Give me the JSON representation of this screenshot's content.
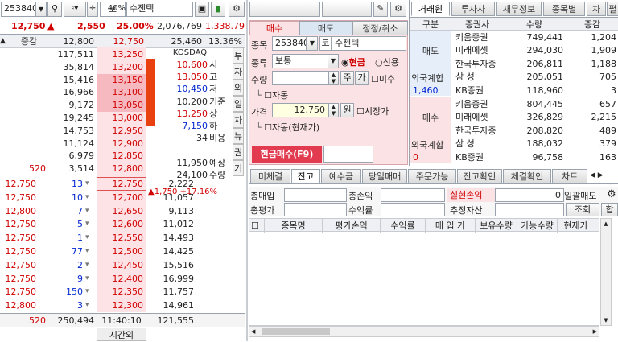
{
  "top": {
    "code": "253840",
    "extra": "코",
    "pct": "40%",
    "name": "수젠텍"
  },
  "summary": {
    "price": "12,750",
    "arrow": "▲",
    "change": "2,550",
    "rate": "25.00%",
    "volume": "2,076,769",
    "extra": "1,338.79"
  },
  "ob_header": {
    "label": "증감",
    "prev": "12,800",
    "cur": "12,750",
    "vol": "25,460",
    "ratio": "13.36%"
  },
  "asks": [
    {
      "cnt": "",
      "qty": "117,511",
      "price": "13,250"
    },
    {
      "cnt": "",
      "qty": "35,814",
      "price": "13,200"
    },
    {
      "cnt": "",
      "qty": "15,416",
      "price": "13,150"
    },
    {
      "cnt": "",
      "qty": "16,966",
      "price": "13,100"
    },
    {
      "cnt": "",
      "qty": "9,172",
      "price": "13,050"
    },
    {
      "cnt": "",
      "qty": "19,245",
      "price": "13,000"
    },
    {
      "cnt": "",
      "qty": "14,753",
      "price": "12,950"
    },
    {
      "cnt": "",
      "qty": "11,124",
      "price": "12,900"
    },
    {
      "cnt": "",
      "qty": "6,979",
      "price": "12,850"
    },
    {
      "cnt": "520",
      "qty": "3,514",
      "price": "12,800"
    }
  ],
  "info": {
    "market": "KOSDAQ",
    "rows": [
      {
        "v": "10,600",
        "k": "시"
      },
      {
        "v": "13,050",
        "k": "고"
      },
      {
        "v": "10,450",
        "k": "저"
      },
      {
        "v": "10,200",
        "k": "기준"
      },
      {
        "v": "13,250",
        "k": "상"
      },
      {
        "v": "7,150",
        "k": "하"
      },
      {
        "v": "34",
        "k": "비용"
      },
      {
        "v": "",
        "k": ""
      },
      {
        "v": "11,950",
        "k": "예상"
      },
      {
        "v": "24,100",
        "k": "수량"
      }
    ],
    "exp_arrow": "▲",
    "exp_change": "1,750",
    "exp_rate": "+17.16%"
  },
  "side_tabs": [
    "투",
    "자",
    "외",
    "일",
    "차",
    "뉴",
    "권",
    "기"
  ],
  "bids": [
    {
      "trade": "12,750",
      "tq": "13",
      "price": "12,750",
      "qty": "2,222"
    },
    {
      "trade": "12,750",
      "tq": "10",
      "price": "12,700",
      "qty": "11,057"
    },
    {
      "trade": "12,800",
      "tq": "7",
      "price": "12,650",
      "qty": "9,113"
    },
    {
      "trade": "12,750",
      "tq": "5",
      "price": "12,600",
      "qty": "11,012"
    },
    {
      "trade": "12,750",
      "tq": "1",
      "price": "12,550",
      "qty": "14,493"
    },
    {
      "trade": "12,750",
      "tq": "77",
      "price": "12,500",
      "qty": "14,425"
    },
    {
      "trade": "12,750",
      "tq": "2",
      "price": "12,450",
      "qty": "15,516"
    },
    {
      "trade": "12,750",
      "tq": "9",
      "price": "12,400",
      "qty": "16,999"
    },
    {
      "trade": "12,750",
      "tq": "150",
      "price": "12,350",
      "qty": "11,757"
    },
    {
      "trade": "12,800",
      "tq": "3",
      "price": "12,300",
      "qty": "14,961"
    }
  ],
  "ob_footer": {
    "cnt": "520",
    "ask_total": "250,494",
    "time": "11:40:10",
    "bid_total": "121,555",
    "after": "시간외"
  },
  "order": {
    "tabs": [
      "매수",
      "매도",
      "정정/취소"
    ],
    "code": "253840",
    "market": "코",
    "name": "수젠텍",
    "type_label": "종류",
    "type": "보통",
    "cash": "현금",
    "credit": "신용",
    "qty_label": "수량",
    "ju": "주",
    "ga": "가",
    "misu": "미수",
    "auto": "자동",
    "price_label": "가격",
    "price": "12,750",
    "won": "원",
    "market_price": "시장가",
    "auto2": "자동(현재가)",
    "submit": "현금매수(F9)",
    "code_label": "종목"
  },
  "broker": {
    "tabs": [
      "거래원",
      "투자자",
      "재무정보",
      "종목별",
      "차",
      "펼"
    ],
    "headers": [
      "구분",
      "증권사",
      "수량",
      "증감"
    ],
    "sell_label": "매도",
    "buy_label": "매수",
    "sells": [
      {
        "name": "키움증권",
        "qty": "749,441",
        "chg": "1,204"
      },
      {
        "name": "미래에셋",
        "qty": "294,030",
        "chg": "1,909"
      },
      {
        "name": "한국투자증",
        "qty": "206,811",
        "chg": "1,188"
      },
      {
        "name": "삼 성",
        "qty": "205,051",
        "chg": "705"
      },
      {
        "name": "KB증권",
        "qty": "118,960",
        "chg": "3"
      }
    ],
    "buys": [
      {
        "name": "키움증권",
        "qty": "804,445",
        "chg": "657"
      },
      {
        "name": "미래에셋",
        "qty": "326,829",
        "chg": "2,215"
      },
      {
        "name": "한국투자증",
        "qty": "208,820",
        "chg": "489"
      },
      {
        "name": "삼 성",
        "qty": "188,032",
        "chg": "379"
      },
      {
        "name": "KB증권",
        "qty": "96,758",
        "chg": "163"
      }
    ],
    "foreign_label": "외국계합",
    "foreign_sell": "1,460",
    "foreign_buy": "0"
  },
  "account": {
    "tabs": [
      "미체결",
      "잔고",
      "예수금",
      "당일매매",
      "주문가능",
      "잔고확인",
      "체결확인",
      "차트"
    ],
    "l1": "총매입",
    "l2": "총손익",
    "l3": "실현손익",
    "v3": "0",
    "l4": "일괄매도",
    "l5": "총평가",
    "l6": "수익률",
    "l7": "추정자산",
    "b1": "조회",
    "b2": "합",
    "cols": [
      "종목명",
      "평가손익",
      "수익률",
      "매 입 가",
      "보유수량",
      "가능수량",
      "현재가"
    ]
  },
  "colors": {
    "red": "#d00000",
    "blue": "#0026d0",
    "pink": "#fde3e6",
    "orange": "#e8410f"
  }
}
